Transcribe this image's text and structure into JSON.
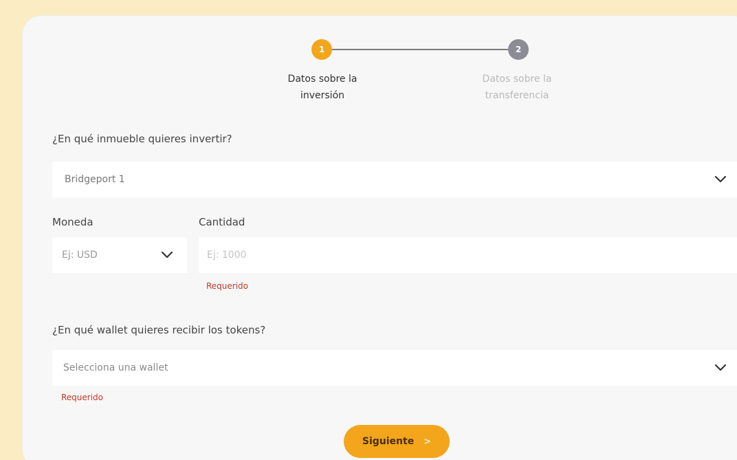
{
  "stepper": {
    "steps": [
      {
        "number": "1",
        "label_line1": "Datos sobre la",
        "label_line2": "inversión",
        "state": "active"
      },
      {
        "number": "2",
        "label_line1": "Datos sobre la",
        "label_line2": "transferencia",
        "state": "inactive"
      }
    ]
  },
  "form": {
    "property": {
      "label": "¿En qué inmueble quieres invertir?",
      "value": "Bridgeport 1"
    },
    "currency": {
      "label": "Moneda",
      "placeholder": "Ej: USD"
    },
    "amount": {
      "label": "Cantidad",
      "placeholder": "Ej: 1000",
      "error": "Requerido"
    },
    "wallet": {
      "label": "¿En qué wallet quieres recibir los tokens?",
      "placeholder": "Selecciona una wallet",
      "error": "Requerido"
    }
  },
  "actions": {
    "next_label": "Siguiente",
    "next_arrow": ">"
  },
  "colors": {
    "background": "#fcecc3",
    "accent": "#f3a61b",
    "inactive_step": "#8c8c96",
    "error": "#c0392b"
  },
  "icons": {
    "dropdown": "chevron-down-icon"
  }
}
